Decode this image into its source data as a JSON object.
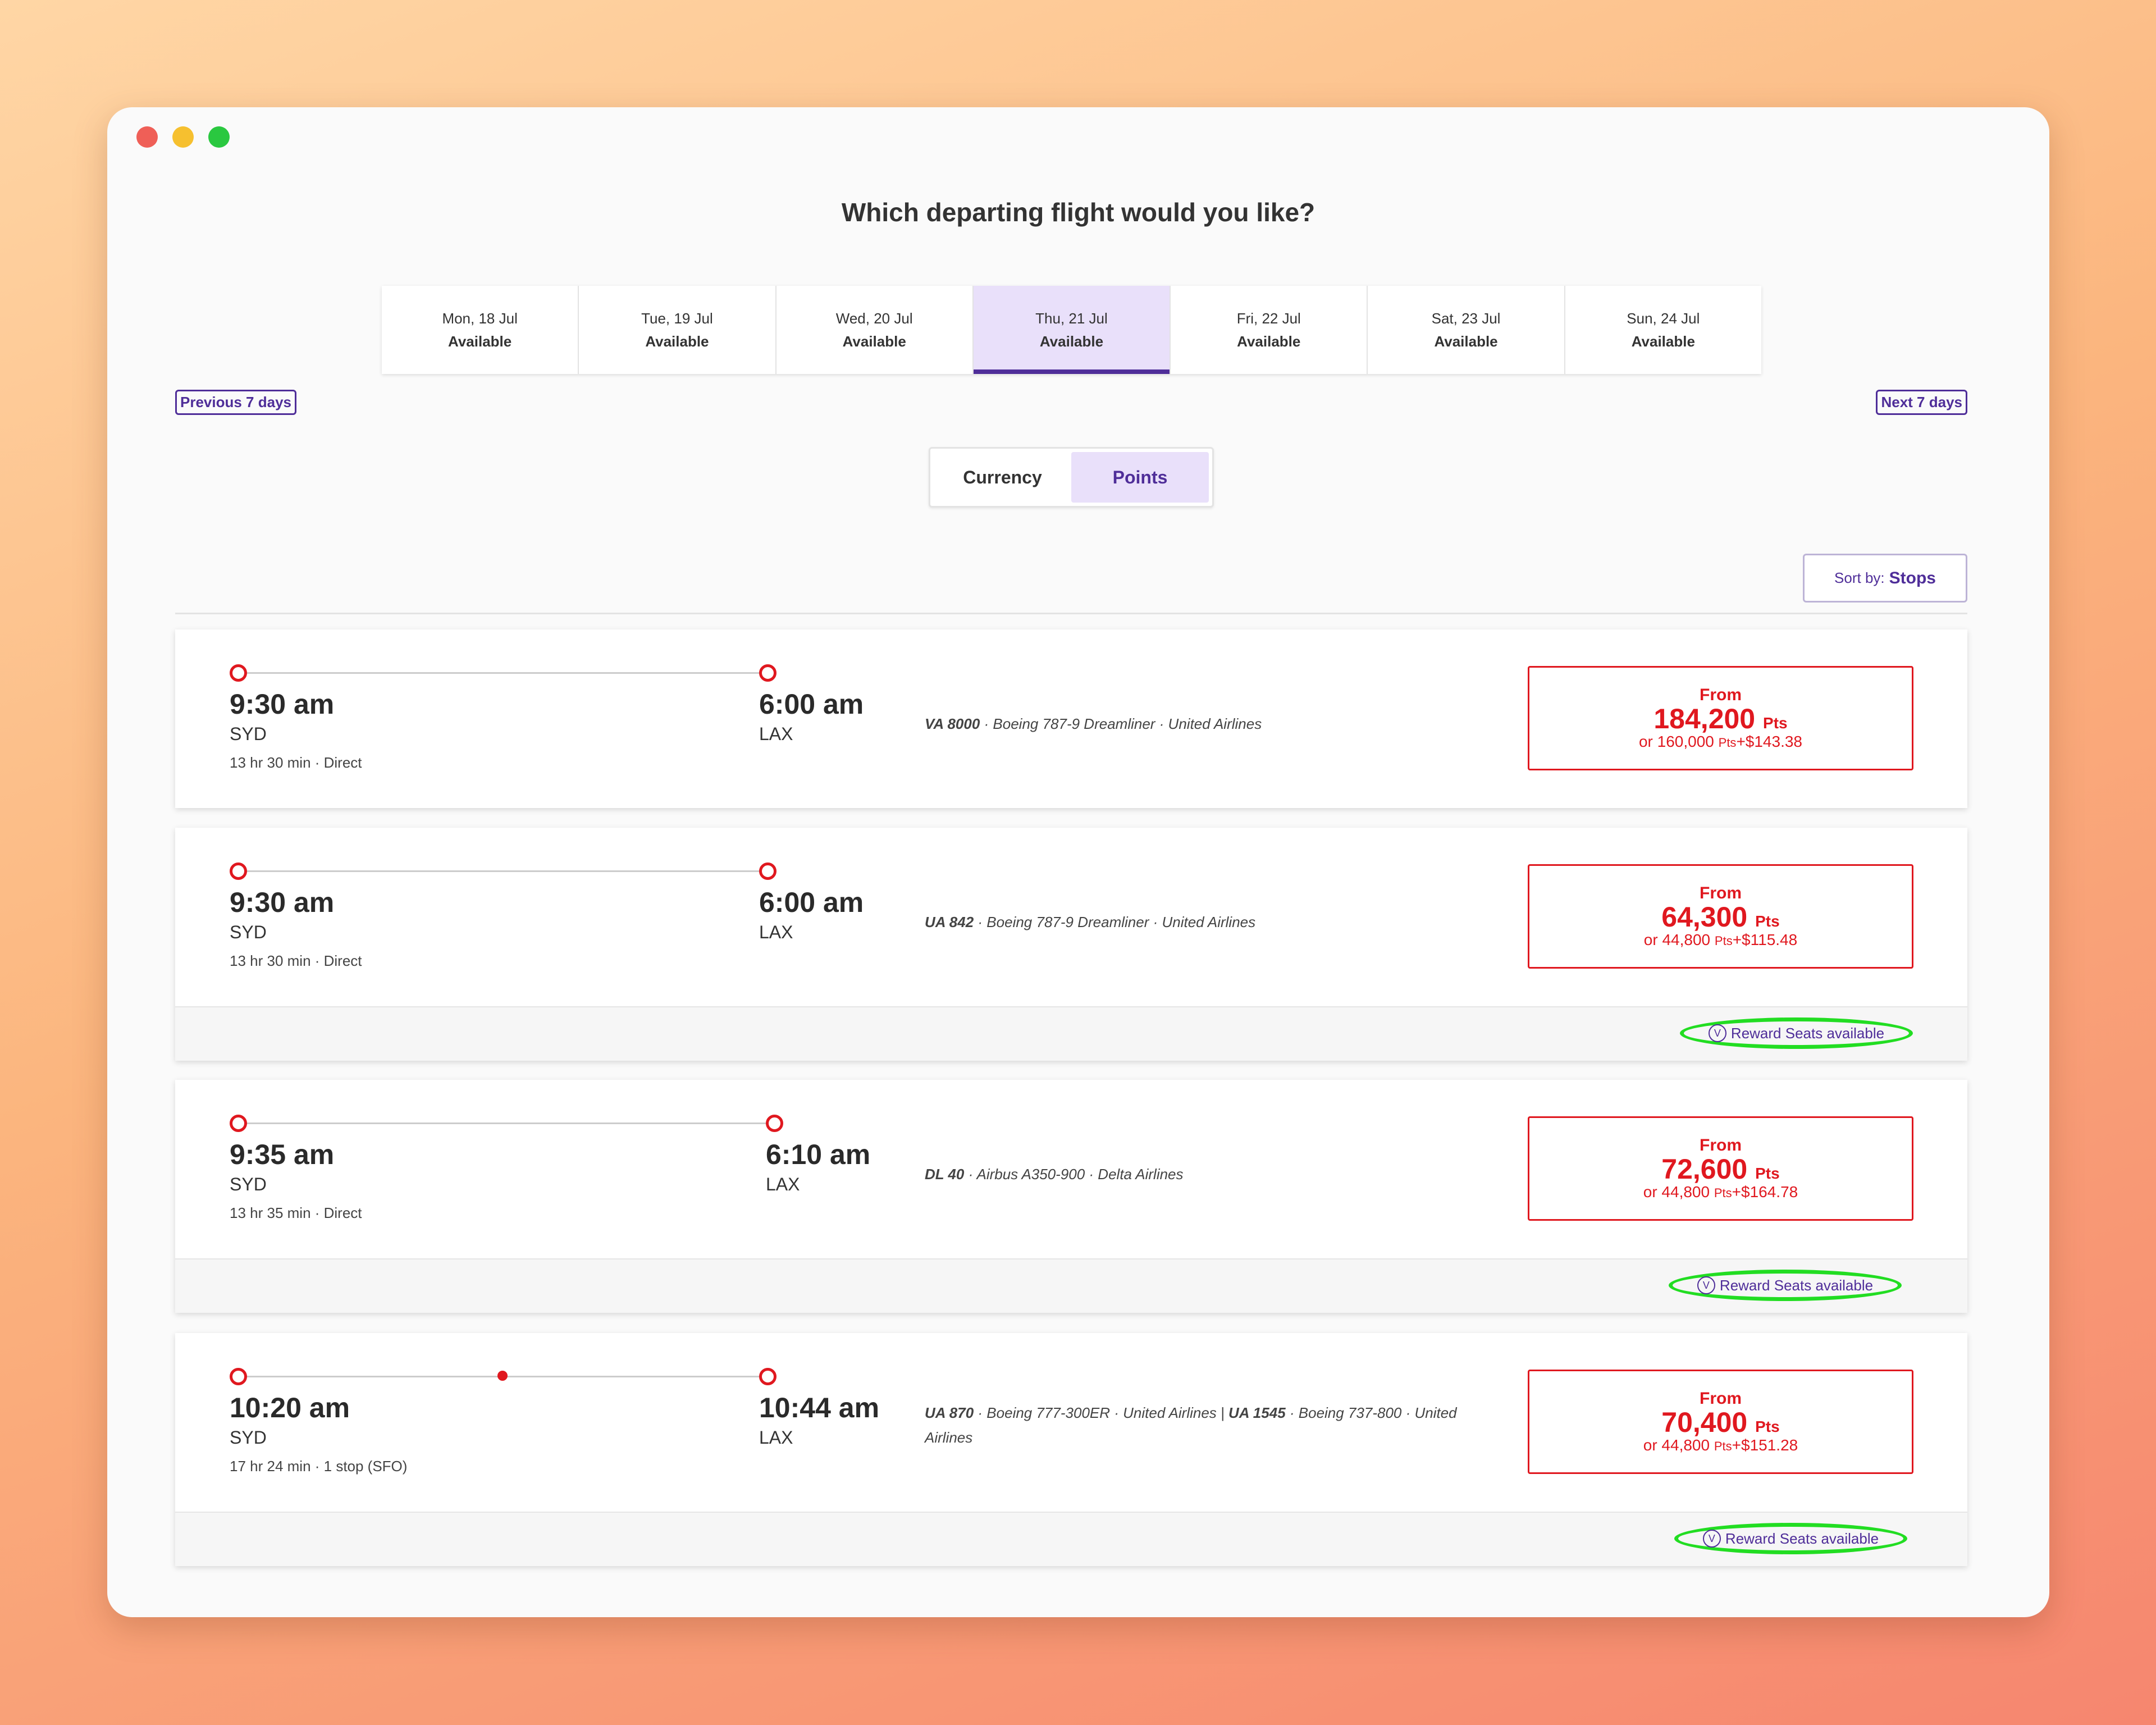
{
  "page": {
    "title": "Which departing flight would you like?",
    "dates": [
      {
        "date": "Mon, 18 Jul",
        "status": "Available"
      },
      {
        "date": "Tue, 19 Jul",
        "status": "Available"
      },
      {
        "date": "Wed, 20 Jul",
        "status": "Available"
      },
      {
        "date": "Thu, 21 Jul",
        "status": "Available"
      },
      {
        "date": "Fri, 22 Jul",
        "status": "Available"
      },
      {
        "date": "Sat, 23 Jul",
        "status": "Available"
      },
      {
        "date": "Sun, 24 Jul",
        "status": "Available"
      }
    ],
    "selected_date_index": 3,
    "prev_label": "Previous 7 days",
    "next_label": "Next 7 days",
    "toggle": {
      "currency": "Currency",
      "points": "Points",
      "active": "Points"
    },
    "sort": {
      "label": "Sort by:",
      "value": "Stops"
    }
  },
  "flights": [
    {
      "depart_time": "9:30 am",
      "depart_code": "SYD",
      "arrive_time": "6:00 am",
      "arrive_code": "LAX",
      "duration": "13 hr 30 min · Direct",
      "flight_no": "VA 8000",
      "details": " · Boeing 787-9 Dreamliner · United Airlines",
      "price_from": "From",
      "points": "184,200",
      "pts_unit": "Pts",
      "alt_prefix": "or 160,000",
      "alt_unit": "Pts",
      "alt_cash": "+$143.38",
      "reward": ""
    },
    {
      "depart_time": "9:30 am",
      "depart_code": "SYD",
      "arrive_time": "6:00 am",
      "arrive_code": "LAX",
      "duration": "13 hr 30 min · Direct",
      "flight_no": "UA 842",
      "details": " · Boeing 787-9 Dreamliner · United Airlines",
      "price_from": "From",
      "points": "64,300",
      "pts_unit": "Pts",
      "alt_prefix": "or 44,800",
      "alt_unit": "Pts",
      "alt_cash": "+$115.48",
      "reward": "Reward Seats available"
    },
    {
      "depart_time": "9:35 am",
      "depart_code": "SYD",
      "arrive_time": "6:10 am",
      "arrive_code": "LAX",
      "duration": "13 hr 35 min · Direct",
      "flight_no": "DL 40",
      "details": " · Airbus A350-900 · Delta Airlines",
      "price_from": "From",
      "points": "72,600",
      "pts_unit": "Pts",
      "alt_prefix": "or 44,800",
      "alt_unit": "Pts",
      "alt_cash": "+$164.78",
      "reward": "Reward Seats available"
    },
    {
      "depart_time": "10:20 am",
      "depart_code": "SYD",
      "arrive_time": "10:44 am",
      "arrive_code": "LAX",
      "duration": "17 hr 24 min · 1 stop (SFO)",
      "flight_no": "UA 870",
      "details": " · Boeing 777-300ER · United Airlines | ",
      "flight_no_2": "UA 1545",
      "details_2": " · Boeing 737-800 · United Airlines",
      "price_from": "From",
      "points": "70,400",
      "pts_unit": "Pts",
      "alt_prefix": "or 44,800",
      "alt_unit": "Pts",
      "alt_cash": "+$151.28",
      "reward": "Reward Seats available"
    }
  ],
  "icons": {
    "window_controls": [
      "close-dot",
      "minimize-dot",
      "zoom-dot"
    ],
    "reward_icon": "V"
  },
  "colors": {
    "brand": "#4f2e99",
    "price": "#e0181f",
    "reward_highlight": "#22dd22",
    "selected_bg": "#e9e0fa"
  }
}
